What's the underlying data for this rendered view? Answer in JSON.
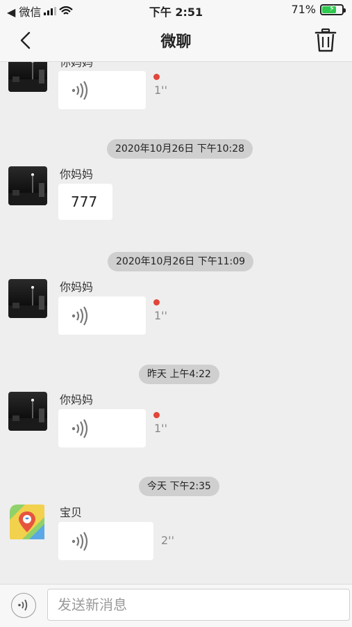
{
  "status_bar": {
    "carrier": "◀ 微信",
    "time": "下午 2:51",
    "battery": "71%",
    "battery_level": 0.71
  },
  "nav": {
    "title": "微聊",
    "back_icon": "chevron-left-icon",
    "delete_icon": "trash-icon"
  },
  "messages": [
    {
      "sender": "你妈妈",
      "type": "voice",
      "duration": "1''",
      "unread": true
    },
    {
      "timestamp": "2020年10月26日 下午10:28"
    },
    {
      "sender": "你妈妈",
      "type": "text",
      "text": "777"
    },
    {
      "timestamp": "2020年10月26日 下午11:09"
    },
    {
      "sender": "你妈妈",
      "type": "voice",
      "duration": "1''",
      "unread": true
    },
    {
      "timestamp": "昨天 上午4:22"
    },
    {
      "sender": "你妈妈",
      "type": "voice",
      "duration": "1''",
      "unread": true
    },
    {
      "timestamp": "今天 下午2:35"
    },
    {
      "sender": "宝贝",
      "type": "voice",
      "duration": "2''",
      "unread": false
    }
  ],
  "input": {
    "placeholder": "发送新消息",
    "voice_icon": "voice-icon"
  },
  "colors": {
    "unread_dot": "#e0463a",
    "battery_fill": "#2dc84d"
  }
}
